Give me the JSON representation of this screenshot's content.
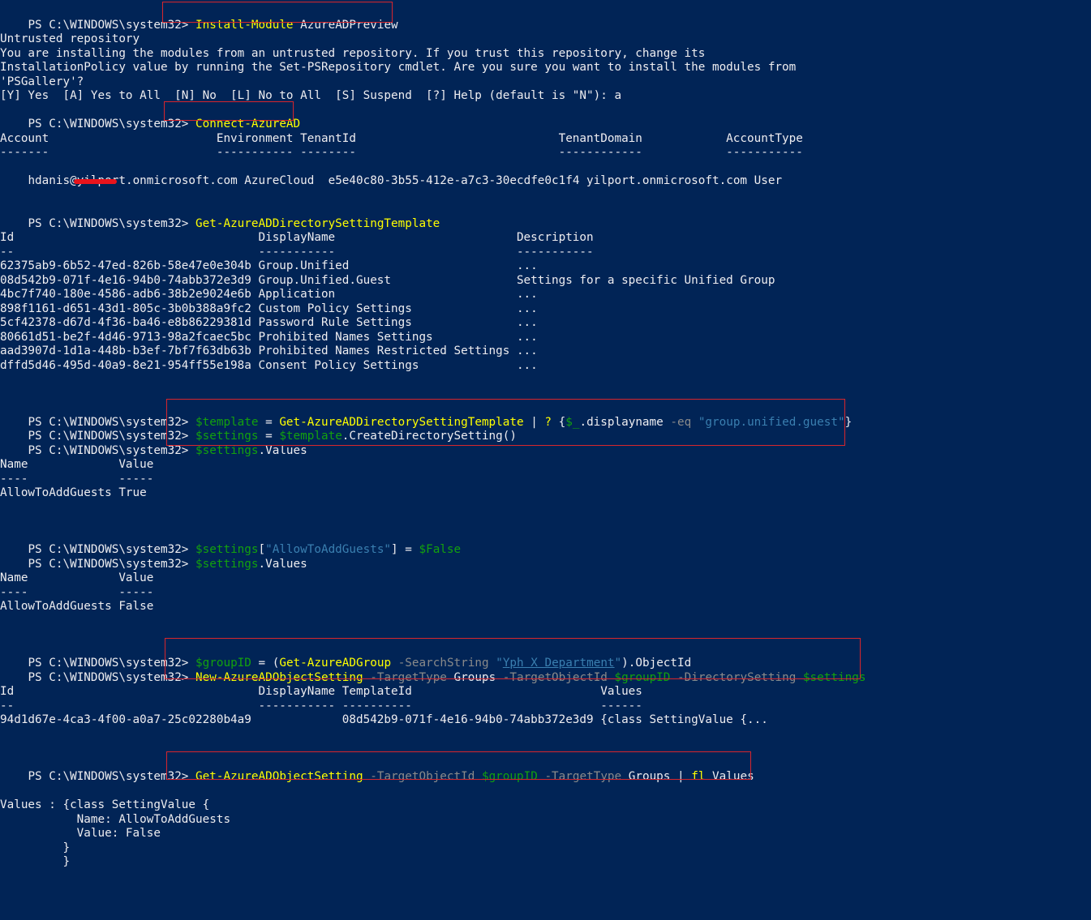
{
  "prompt": "PS C:\\WINDOWS\\system32> ",
  "blocks": {
    "install": {
      "command": [
        {
          "t": "Install-Module",
          "c": "cmd"
        },
        {
          "t": " AzureADPreview",
          "c": "plain"
        }
      ]
    },
    "untrusted": {
      "title": "Untrusted repository",
      "message_lines": [
        "You are installing the modules from an untrusted repository. If you trust this repository, change its",
        "InstallationPolicy value by running the Set-PSRepository cmdlet. Are you sure you want to install the modules from",
        "'PSGallery'?"
      ],
      "choices": "[Y] Yes  [A] Yes to All  [N] No  [L] No to All  [S] Suspend  [?] Help (default is \"N\"): a"
    },
    "connect": {
      "command": [
        {
          "t": "Connect-AzureAD",
          "c": "cmd"
        }
      ]
    },
    "account_table": {
      "header": "Account                        Environment TenantId                             TenantDomain            AccountType",
      "divider": "-------                        ----------- --------                             ------------            -----------",
      "row_prefix": "hdanis@",
      "row_redacted": "yilpor",
      "row_rest": "t.onmicrosoft.com AzureCloud  e5e40c80-3b55-412e-a7c3-30ecdfe0c1f4 yilport.onmicrosoft.com User"
    },
    "template_cmd": {
      "command": [
        {
          "t": "Get-AzureADDirectorySettingTemplate",
          "c": "cmd"
        }
      ]
    },
    "template_table": {
      "header": "Id                                   DisplayName                          Description",
      "divider": "--                                   -----------                          -----------",
      "rows": [
        "62375ab9-6b52-47ed-826b-58e47e0e304b Group.Unified                        ...",
        "08d542b9-071f-4e16-94b0-74abb372e3d9 Group.Unified.Guest                  Settings for a specific Unified Group",
        "4bc7f740-180e-4586-adb6-38b2e9024e6b Application                          ...",
        "898f1161-d651-43d1-805c-3b0b388a9fc2 Custom Policy Settings               ...",
        "5cf42378-d67d-4f36-ba46-e8b86229381d Password Rule Settings               ...",
        "80661d51-be2f-4d46-9713-98a2fcaec5bc Prohibited Names Settings            ...",
        "aad3907d-1d1a-448b-b3ef-7bf7f63db63b Prohibited Names Restricted Settings ...",
        "dffd5d46-495d-40a9-8e21-954ff55e198a Consent Policy Settings              ..."
      ]
    },
    "settings_cmds": [
      [
        {
          "t": "$template",
          "c": "var"
        },
        {
          "t": " = ",
          "c": "plain"
        },
        {
          "t": "Get-AzureADDirectorySettingTemplate",
          "c": "cmd"
        },
        {
          "t": " | ",
          "c": "plain"
        },
        {
          "t": "?",
          "c": "cmd"
        },
        {
          "t": " {",
          "c": "plain"
        },
        {
          "t": "$_",
          "c": "var"
        },
        {
          "t": ".displayname ",
          "c": "plain"
        },
        {
          "t": "-eq",
          "c": "param"
        },
        {
          "t": " ",
          "c": "plain"
        },
        {
          "t": "\"group.unified.guest\"",
          "c": "str"
        },
        {
          "t": "}",
          "c": "plain"
        }
      ],
      [
        {
          "t": "$settings",
          "c": "var"
        },
        {
          "t": " = ",
          "c": "plain"
        },
        {
          "t": "$template",
          "c": "var"
        },
        {
          "t": ".CreateDirectorySetting()",
          "c": "plain"
        }
      ],
      [
        {
          "t": "$settings",
          "c": "var"
        },
        {
          "t": ".Values",
          "c": "plain"
        }
      ]
    ],
    "values_table_1": {
      "header": "Name             Value",
      "divider": "----             -----",
      "row": "AllowToAddGuests True"
    },
    "set_false_cmds": [
      [
        {
          "t": "$settings",
          "c": "var"
        },
        {
          "t": "[",
          "c": "plain"
        },
        {
          "t": "\"AllowToAddGuests\"",
          "c": "str"
        },
        {
          "t": "] = ",
          "c": "plain"
        },
        {
          "t": "$False",
          "c": "var"
        }
      ],
      [
        {
          "t": "$settings",
          "c": "var"
        },
        {
          "t": ".Values",
          "c": "plain"
        }
      ]
    ],
    "values_table_2": {
      "header": "Name             Value",
      "divider": "----             -----",
      "row": "AllowToAddGuests False"
    },
    "group_cmds": [
      [
        {
          "t": "$groupID",
          "c": "var"
        },
        {
          "t": " = (",
          "c": "plain"
        },
        {
          "t": "Get-AzureADGroup",
          "c": "cmd"
        },
        {
          "t": " ",
          "c": "plain"
        },
        {
          "t": "-SearchString",
          "c": "param"
        },
        {
          "t": " ",
          "c": "plain"
        },
        {
          "t": "\"",
          "c": "str"
        },
        {
          "t": "Yph X Department",
          "c": "strlink"
        },
        {
          "t": "\"",
          "c": "str"
        },
        {
          "t": ").ObjectId",
          "c": "plain"
        }
      ],
      [
        {
          "t": "New-AzureADObjectSetting",
          "c": "cmd"
        },
        {
          "t": " ",
          "c": "plain"
        },
        {
          "t": "-TargetType",
          "c": "param"
        },
        {
          "t": " Groups ",
          "c": "plain"
        },
        {
          "t": "-TargetObjectId",
          "c": "param"
        },
        {
          "t": " ",
          "c": "plain"
        },
        {
          "t": "$groupID",
          "c": "var"
        },
        {
          "t": " ",
          "c": "plain"
        },
        {
          "t": "-DirectorySetting",
          "c": "param"
        },
        {
          "t": " ",
          "c": "plain"
        },
        {
          "t": "$settings",
          "c": "var"
        }
      ]
    ],
    "object_table": {
      "header": "Id                                   DisplayName TemplateId                           Values",
      "divider": "--                                   ----------- ----------                           ------",
      "row": "94d1d67e-4ca3-4f00-a0a7-25c02280b4a9             08d542b9-071f-4e16-94b0-74abb372e3d9 {class SettingValue {..."
    },
    "get_cmd": [
      [
        {
          "t": "Get-AzureADObjectSetting",
          "c": "cmd"
        },
        {
          "t": " ",
          "c": "plain"
        },
        {
          "t": "-TargetObjectId",
          "c": "param"
        },
        {
          "t": " ",
          "c": "plain"
        },
        {
          "t": "$groupID",
          "c": "var"
        },
        {
          "t": " ",
          "c": "plain"
        },
        {
          "t": "-TargetType",
          "c": "param"
        },
        {
          "t": " Groups | ",
          "c": "plain"
        },
        {
          "t": "fl",
          "c": "cmd"
        },
        {
          "t": " Values",
          "c": "plain"
        }
      ]
    ],
    "final_output": [
      "Values : {class SettingValue {",
      "           Name: AllowToAddGuests",
      "           Value: False",
      "         }",
      "         }"
    ]
  },
  "colors": {
    "background": "#012456",
    "text": "#eeedf0",
    "command": "#ffff00",
    "variable": "#13a10e",
    "parameter": "#8a8a8a",
    "string": "#3a7fb0",
    "highlight_box": "#d8262c",
    "redaction": "#e8141c"
  }
}
